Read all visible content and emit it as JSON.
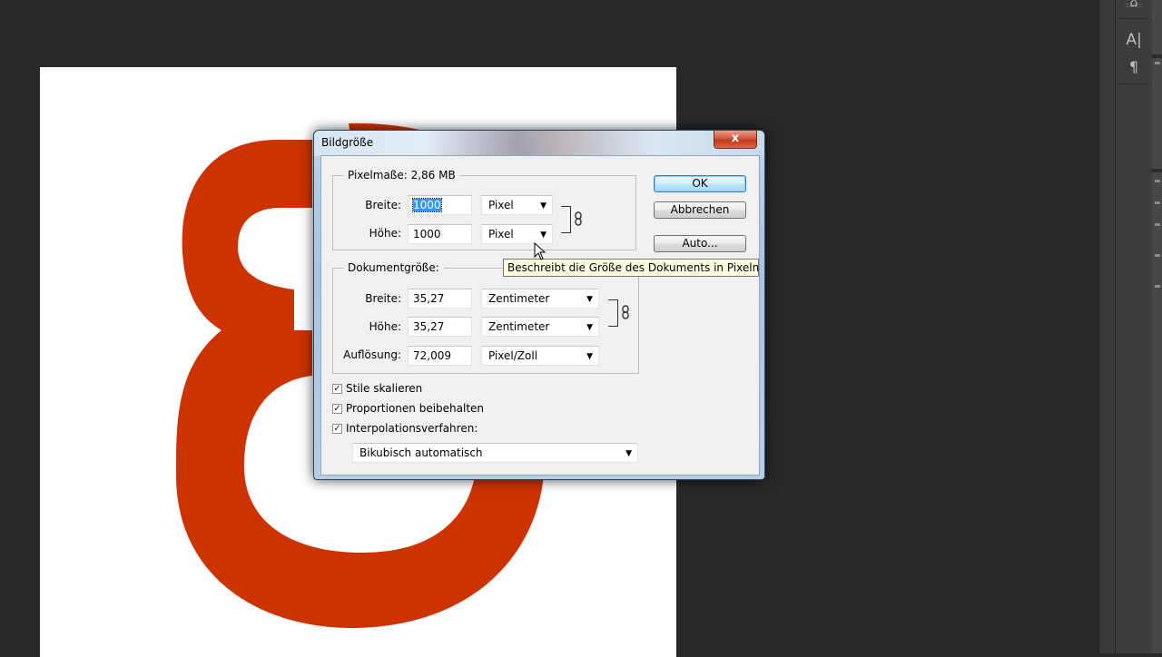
{
  "dialog": {
    "title": "Bildgröße",
    "close_label": "x"
  },
  "pixel_dimensions": {
    "legend": "Pixelmaße: 2,86 MB",
    "width_label": "Breite:",
    "width_value": "1000",
    "width_unit": "Pixel",
    "height_label": "Höhe:",
    "height_value": "1000",
    "height_unit": "Pixel"
  },
  "document_size": {
    "legend": "Dokumentgröße:",
    "width_label": "Breite:",
    "width_value": "35,27",
    "width_unit": "Zentimeter",
    "height_label": "Höhe:",
    "height_value": "35,27",
    "height_unit": "Zentimeter",
    "resolution_label": "Auflösung:",
    "resolution_value": "72,009",
    "resolution_unit": "Pixel/Zoll"
  },
  "buttons": {
    "ok": "OK",
    "cancel": "Abbrechen",
    "auto": "Auto..."
  },
  "options": {
    "scale_styles": {
      "label": "Stile skalieren",
      "checked": true
    },
    "constrain": {
      "label": "Proportionen beibehalten",
      "checked": true
    },
    "resample": {
      "label": "Interpolationsverfahren:",
      "checked": true
    },
    "resample_method": "Bikubisch automatisch"
  },
  "tooltip": "Beschreibt die Größe des Dokuments in Pixeln",
  "check_glyph": "✓",
  "dropdown_arrow": "▼",
  "panel_icons": {
    "character": "A|",
    "paragraph": "¶",
    "top": "⌂"
  },
  "colors": {
    "canvas_bg": "#ffffff",
    "ampersand": "#cc3300",
    "workspace": "#282828",
    "tooltip_bg": "#ffffe1"
  }
}
